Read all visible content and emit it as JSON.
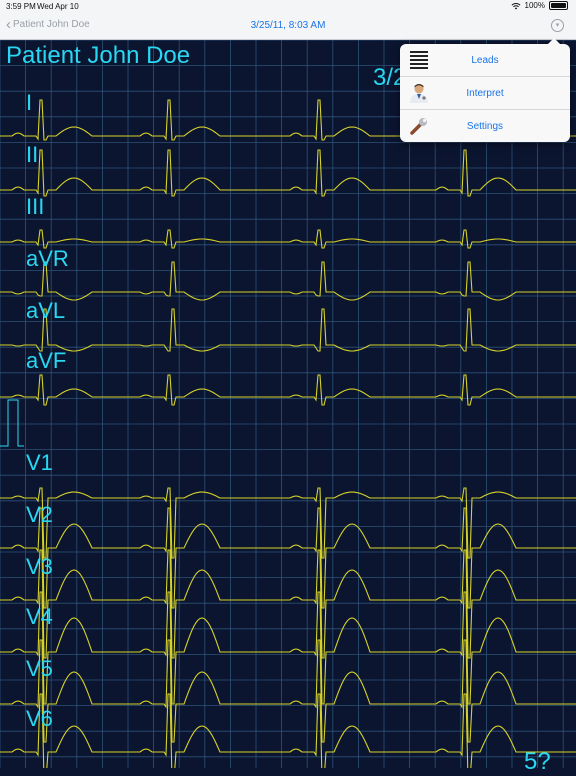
{
  "status": {
    "time": "3:59 PM",
    "date": "Wed Apr 10",
    "battery": "100%"
  },
  "nav": {
    "back_label": "Patient John Doe",
    "title": "3/25/11, 8:03 AM"
  },
  "ecg": {
    "patient_name": "Patient John Doe",
    "date_partial": "3/2",
    "corner_text": "5?",
    "leads": [
      "I",
      "II",
      "III",
      "aVR",
      "aVL",
      "aVF",
      "V1",
      "V2",
      "V3",
      "V4",
      "V5",
      "V6"
    ],
    "grid_color": "#2d5278",
    "trace_color": "#d6d22a",
    "label_color": "#29d7f2"
  },
  "menu": {
    "items": [
      {
        "label": "Leads",
        "icon": "list-icon"
      },
      {
        "label": "Interpret",
        "icon": "doctor-icon"
      },
      {
        "label": "Settings",
        "icon": "wrench-icon"
      }
    ]
  }
}
